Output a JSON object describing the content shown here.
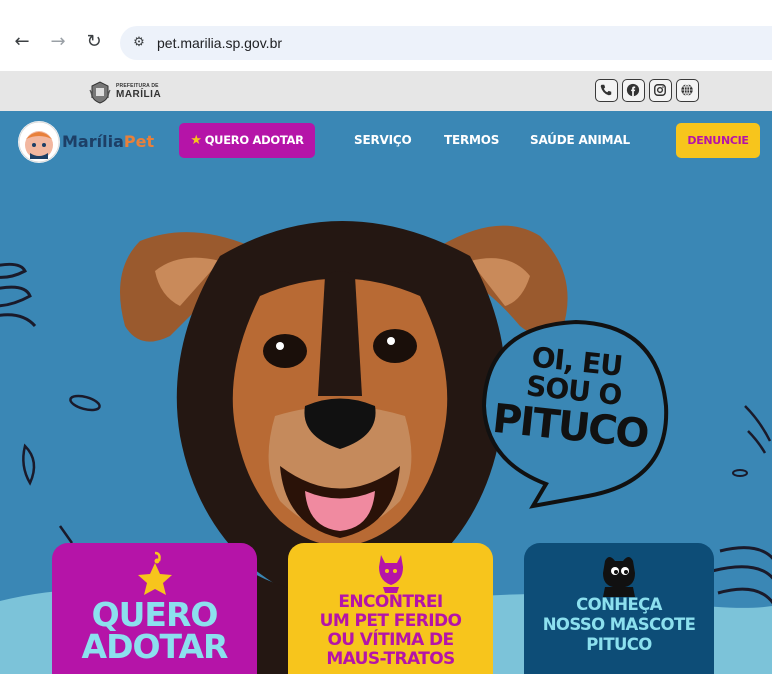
{
  "browser": {
    "url": "pet.marilia.sp.gov.br",
    "back_glyph": "←",
    "forward_glyph": "→",
    "reload_glyph": "↻",
    "site_info_glyph": "⚙"
  },
  "gov_bar": {
    "logo_line1": "PREFEITURA DE",
    "logo_line2": "MARÍLIA",
    "social_icons": [
      "phone-icon",
      "facebook-icon",
      "instagram-icon",
      "globe-icon"
    ]
  },
  "nav": {
    "brand_part1": "Marília",
    "brand_part2": "Pet",
    "adotar_star": "★",
    "adotar_label": "QUERO ADOTAR",
    "links": [
      "SERVIÇO",
      "TERMOS",
      "SAÚDE ANIMAL"
    ],
    "denuncie_label": "DENUNCIE"
  },
  "hero": {
    "bubble_line1": "OI, EU",
    "bubble_line2": "SOU O",
    "bubble_line3": "PITUCO"
  },
  "cards": [
    {
      "line1": "QUERO",
      "line2": "ADOTAR",
      "icon": "star-tag-icon"
    },
    {
      "line1": "ENCONTREI",
      "line2": "UM PET FERIDO",
      "line3": "OU VÍTIMA DE",
      "line4": "MAUS-TRATOS",
      "icon": "injured-pet-icon"
    },
    {
      "line1": "CONHEÇA",
      "line2": "NOSSO MASCOTE",
      "line3": "PITUCO",
      "icon": "dog-mascot-icon"
    }
  ],
  "colors": {
    "hero_bg": "#3a87b5",
    "magenta": "#b514a8",
    "yellow": "#f7c51c",
    "navy": "#0d4d77",
    "cyan_text": "#8ce0ee"
  }
}
